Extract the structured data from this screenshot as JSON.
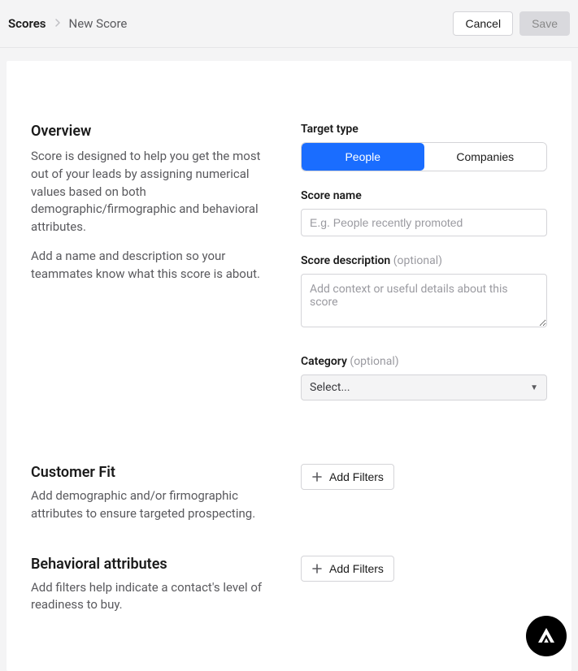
{
  "breadcrumb": {
    "root": "Scores",
    "current": "New Score"
  },
  "header": {
    "cancel": "Cancel",
    "save": "Save"
  },
  "overview": {
    "title": "Overview",
    "desc1": "Score is designed to help you get the most out of your leads by assigning numerical values based on both demographic/firmographic and behavioral attributes.",
    "desc2": "Add a name and description so your teammates know what this score is about."
  },
  "targetType": {
    "label": "Target type",
    "options": {
      "people": "People",
      "companies": "Companies"
    }
  },
  "scoreName": {
    "label": "Score name",
    "placeholder": "E.g. People recently promoted"
  },
  "scoreDescription": {
    "label": "Score description",
    "optional": "(optional)",
    "placeholder": "Add context or useful details about this score"
  },
  "category": {
    "label": "Category",
    "optional": "(optional)",
    "placeholder": "Select..."
  },
  "customerFit": {
    "title": "Customer Fit",
    "desc": "Add demographic and/or firmographic attributes to ensure targeted prospecting.",
    "button": "Add Filters"
  },
  "behavioral": {
    "title": "Behavioral attributes",
    "desc": "Add filters help indicate a contact's level of readiness to buy.",
    "button": "Add Filters"
  }
}
